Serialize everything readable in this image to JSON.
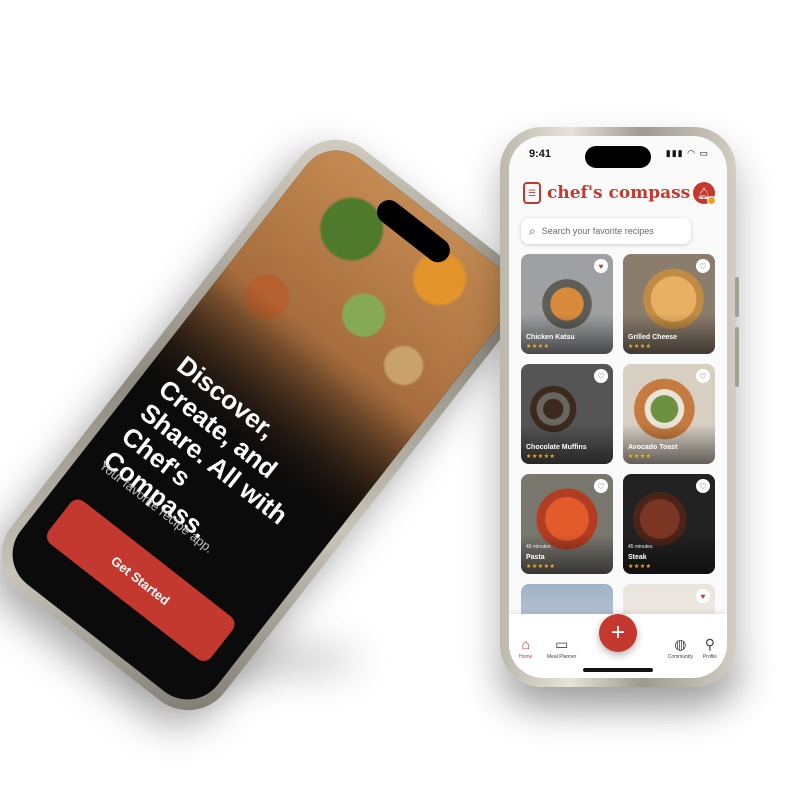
{
  "onboarding": {
    "headline": "Discover, Create, and Share. All with Chef's Compass.",
    "subtitle": "Your favorite recipe app.",
    "cta_label": "Get Started"
  },
  "app": {
    "status_time": "9:41",
    "name": "chef's compass",
    "search_placeholder": "Search your favorite recipes",
    "accent_color": "#c4392f",
    "recipes": [
      {
        "name": "Chicken Katsu",
        "time": "",
        "rating": "★★★★",
        "favorited": true
      },
      {
        "name": "Grilled Cheese",
        "time": "",
        "rating": "★★★★",
        "favorited": false
      },
      {
        "name": "Chocolate Muffins",
        "time": "",
        "rating": "★★★★★",
        "favorited": false
      },
      {
        "name": "Avocado Toast",
        "time": "",
        "rating": "★★★★",
        "favorited": false
      },
      {
        "name": "Pasta",
        "time": "40 minutes",
        "rating": "★★★★★",
        "favorited": false
      },
      {
        "name": "Steak",
        "time": "45 minutes",
        "rating": "★★★★",
        "favorited": false
      },
      {
        "name": "",
        "time": "",
        "rating": "",
        "favorited": false
      },
      {
        "name": "",
        "time": "",
        "rating": "",
        "favorited": true
      }
    ],
    "nav": {
      "home": "Home",
      "meal_planner": "Meal Planner",
      "community": "Community",
      "profile": "Profile"
    },
    "icons": {
      "home": "home-icon",
      "meal_planner": "calendar-icon",
      "add": "plus-icon",
      "community": "globe-icon",
      "profile": "user-icon",
      "notifications": "bell-icon",
      "search": "search-icon"
    }
  }
}
